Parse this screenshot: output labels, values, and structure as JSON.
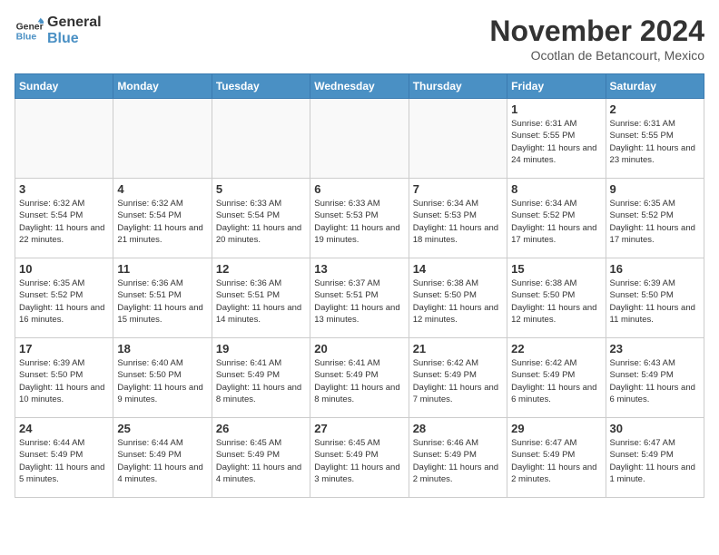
{
  "header": {
    "logo_general": "General",
    "logo_blue": "Blue",
    "month_title": "November 2024",
    "subtitle": "Ocotlan de Betancourt, Mexico"
  },
  "days_of_week": [
    "Sunday",
    "Monday",
    "Tuesday",
    "Wednesday",
    "Thursday",
    "Friday",
    "Saturday"
  ],
  "weeks": [
    [
      {
        "day": "",
        "info": ""
      },
      {
        "day": "",
        "info": ""
      },
      {
        "day": "",
        "info": ""
      },
      {
        "day": "",
        "info": ""
      },
      {
        "day": "",
        "info": ""
      },
      {
        "day": "1",
        "info": "Sunrise: 6:31 AM\nSunset: 5:55 PM\nDaylight: 11 hours and 24 minutes."
      },
      {
        "day": "2",
        "info": "Sunrise: 6:31 AM\nSunset: 5:55 PM\nDaylight: 11 hours and 23 minutes."
      }
    ],
    [
      {
        "day": "3",
        "info": "Sunrise: 6:32 AM\nSunset: 5:54 PM\nDaylight: 11 hours and 22 minutes."
      },
      {
        "day": "4",
        "info": "Sunrise: 6:32 AM\nSunset: 5:54 PM\nDaylight: 11 hours and 21 minutes."
      },
      {
        "day": "5",
        "info": "Sunrise: 6:33 AM\nSunset: 5:54 PM\nDaylight: 11 hours and 20 minutes."
      },
      {
        "day": "6",
        "info": "Sunrise: 6:33 AM\nSunset: 5:53 PM\nDaylight: 11 hours and 19 minutes."
      },
      {
        "day": "7",
        "info": "Sunrise: 6:34 AM\nSunset: 5:53 PM\nDaylight: 11 hours and 18 minutes."
      },
      {
        "day": "8",
        "info": "Sunrise: 6:34 AM\nSunset: 5:52 PM\nDaylight: 11 hours and 17 minutes."
      },
      {
        "day": "9",
        "info": "Sunrise: 6:35 AM\nSunset: 5:52 PM\nDaylight: 11 hours and 17 minutes."
      }
    ],
    [
      {
        "day": "10",
        "info": "Sunrise: 6:35 AM\nSunset: 5:52 PM\nDaylight: 11 hours and 16 minutes."
      },
      {
        "day": "11",
        "info": "Sunrise: 6:36 AM\nSunset: 5:51 PM\nDaylight: 11 hours and 15 minutes."
      },
      {
        "day": "12",
        "info": "Sunrise: 6:36 AM\nSunset: 5:51 PM\nDaylight: 11 hours and 14 minutes."
      },
      {
        "day": "13",
        "info": "Sunrise: 6:37 AM\nSunset: 5:51 PM\nDaylight: 11 hours and 13 minutes."
      },
      {
        "day": "14",
        "info": "Sunrise: 6:38 AM\nSunset: 5:50 PM\nDaylight: 11 hours and 12 minutes."
      },
      {
        "day": "15",
        "info": "Sunrise: 6:38 AM\nSunset: 5:50 PM\nDaylight: 11 hours and 12 minutes."
      },
      {
        "day": "16",
        "info": "Sunrise: 6:39 AM\nSunset: 5:50 PM\nDaylight: 11 hours and 11 minutes."
      }
    ],
    [
      {
        "day": "17",
        "info": "Sunrise: 6:39 AM\nSunset: 5:50 PM\nDaylight: 11 hours and 10 minutes."
      },
      {
        "day": "18",
        "info": "Sunrise: 6:40 AM\nSunset: 5:50 PM\nDaylight: 11 hours and 9 minutes."
      },
      {
        "day": "19",
        "info": "Sunrise: 6:41 AM\nSunset: 5:49 PM\nDaylight: 11 hours and 8 minutes."
      },
      {
        "day": "20",
        "info": "Sunrise: 6:41 AM\nSunset: 5:49 PM\nDaylight: 11 hours and 8 minutes."
      },
      {
        "day": "21",
        "info": "Sunrise: 6:42 AM\nSunset: 5:49 PM\nDaylight: 11 hours and 7 minutes."
      },
      {
        "day": "22",
        "info": "Sunrise: 6:42 AM\nSunset: 5:49 PM\nDaylight: 11 hours and 6 minutes."
      },
      {
        "day": "23",
        "info": "Sunrise: 6:43 AM\nSunset: 5:49 PM\nDaylight: 11 hours and 6 minutes."
      }
    ],
    [
      {
        "day": "24",
        "info": "Sunrise: 6:44 AM\nSunset: 5:49 PM\nDaylight: 11 hours and 5 minutes."
      },
      {
        "day": "25",
        "info": "Sunrise: 6:44 AM\nSunset: 5:49 PM\nDaylight: 11 hours and 4 minutes."
      },
      {
        "day": "26",
        "info": "Sunrise: 6:45 AM\nSunset: 5:49 PM\nDaylight: 11 hours and 4 minutes."
      },
      {
        "day": "27",
        "info": "Sunrise: 6:45 AM\nSunset: 5:49 PM\nDaylight: 11 hours and 3 minutes."
      },
      {
        "day": "28",
        "info": "Sunrise: 6:46 AM\nSunset: 5:49 PM\nDaylight: 11 hours and 2 minutes."
      },
      {
        "day": "29",
        "info": "Sunrise: 6:47 AM\nSunset: 5:49 PM\nDaylight: 11 hours and 2 minutes."
      },
      {
        "day": "30",
        "info": "Sunrise: 6:47 AM\nSunset: 5:49 PM\nDaylight: 11 hours and 1 minute."
      }
    ]
  ]
}
